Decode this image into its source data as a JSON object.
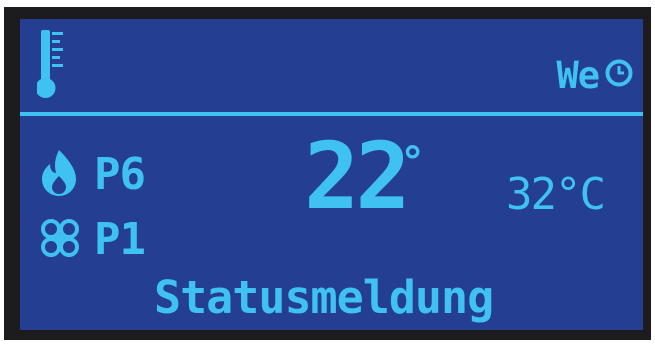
{
  "header": {
    "weekday": "We",
    "thermometer_icon": "thermometer-icon",
    "clock_icon": "clock-icon"
  },
  "main": {
    "burner": {
      "icon": "flame-icon",
      "level": "P6"
    },
    "fan": {
      "icon": "fan-icon",
      "level": "P1"
    },
    "room_temperature": "22",
    "room_temperature_unit": "°",
    "boiler_temperature": "32°C"
  },
  "footer": {
    "status_message": "Statusmeldung"
  },
  "colors": {
    "bezel": "#1c1b1d",
    "screen_background": "#243e91",
    "lcd_foreground": "#3fc1f2"
  }
}
